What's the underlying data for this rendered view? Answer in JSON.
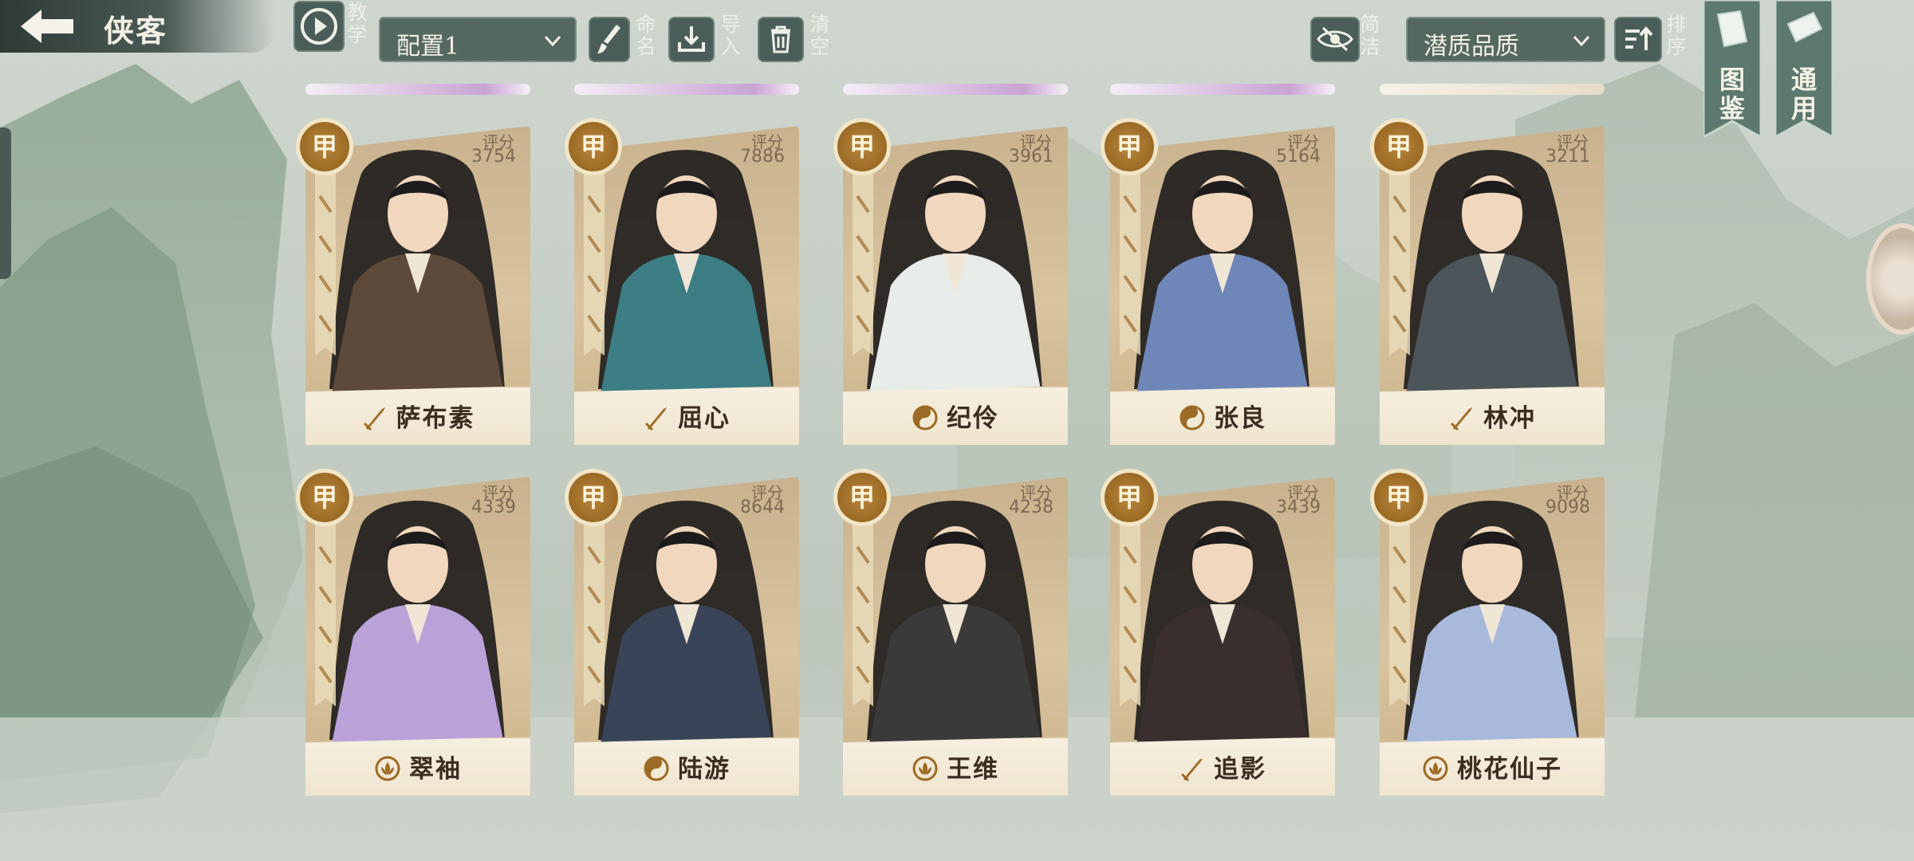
{
  "header": {
    "title": "侠客",
    "tutorial_label": "教学",
    "config_select": "配置1",
    "rename_label": "命名",
    "import_label": "导入",
    "clear_label": "清空",
    "simple_label": "简洁",
    "quality_select": "潜质品质",
    "sort_label": "排序",
    "codex_label": "图鉴",
    "common_label": "通用"
  },
  "score_label": "评分",
  "cards": [
    {
      "name": "萨布素",
      "score": "3754",
      "grade": "甲",
      "icon": "sword-icon",
      "portrait": "warrior-fur-portrait"
    },
    {
      "name": "屈心",
      "score": "7886",
      "grade": "甲",
      "icon": "sword-icon",
      "portrait": "lady-fan-portrait"
    },
    {
      "name": "纪伶",
      "score": "3961",
      "grade": "甲",
      "icon": "taiji-icon",
      "portrait": "maiden-white-portrait"
    },
    {
      "name": "张良",
      "score": "5164",
      "grade": "甲",
      "icon": "taiji-icon",
      "portrait": "scholar-blue-portrait"
    },
    {
      "name": "林冲",
      "score": "3211",
      "grade": "甲",
      "icon": "sword-icon",
      "portrait": "armored-hat-portrait"
    },
    {
      "name": "翠袖",
      "score": "4339",
      "grade": "甲",
      "icon": "lotus-icon",
      "portrait": "lady-purple-portrait"
    },
    {
      "name": "陆游",
      "score": "8644",
      "grade": "甲",
      "icon": "taiji-icon",
      "portrait": "swordsman-red-portrait"
    },
    {
      "name": "王维",
      "score": "4238",
      "grade": "甲",
      "icon": "lotus-icon",
      "portrait": "poet-scroll-portrait"
    },
    {
      "name": "追影",
      "score": "3439",
      "grade": "甲",
      "icon": "sword-icon",
      "portrait": "assassin-black-portrait"
    },
    {
      "name": "桃花仙子",
      "score": "9098",
      "grade": "甲",
      "icon": "lotus-icon",
      "portrait": "fairy-blue-portrait"
    }
  ],
  "colors": {
    "accent": "#9b6a24",
    "bar": "#4a5d58",
    "card": "#d9c49f"
  }
}
